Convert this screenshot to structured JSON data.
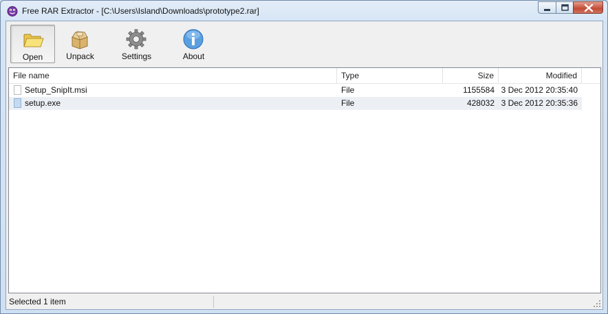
{
  "window": {
    "app_name": "Free RAR Extractor",
    "title": "Free RAR Extractor - [C:\\Users\\Island\\Downloads\\prototype2.rar]"
  },
  "toolbar": {
    "open_label": "Open",
    "unpack_label": "Unpack",
    "settings_label": "Settings",
    "about_label": "About"
  },
  "columns": [
    "File name",
    "Type",
    "Size",
    "Modified"
  ],
  "files": [
    {
      "name": "Setup_SnipIt.msi",
      "type": "File",
      "size": "1155584",
      "modified": "3 Dec 2012 20:35:40"
    },
    {
      "name": "setup.exe",
      "type": "File",
      "size": "428032",
      "modified": "3 Dec 2012 20:35:36"
    }
  ],
  "status": {
    "text": "Selected 1 item"
  },
  "colors": {
    "titlebar": "#d6e5f5",
    "close_button": "#c24b36",
    "selected_row": "#ecf0f5"
  }
}
